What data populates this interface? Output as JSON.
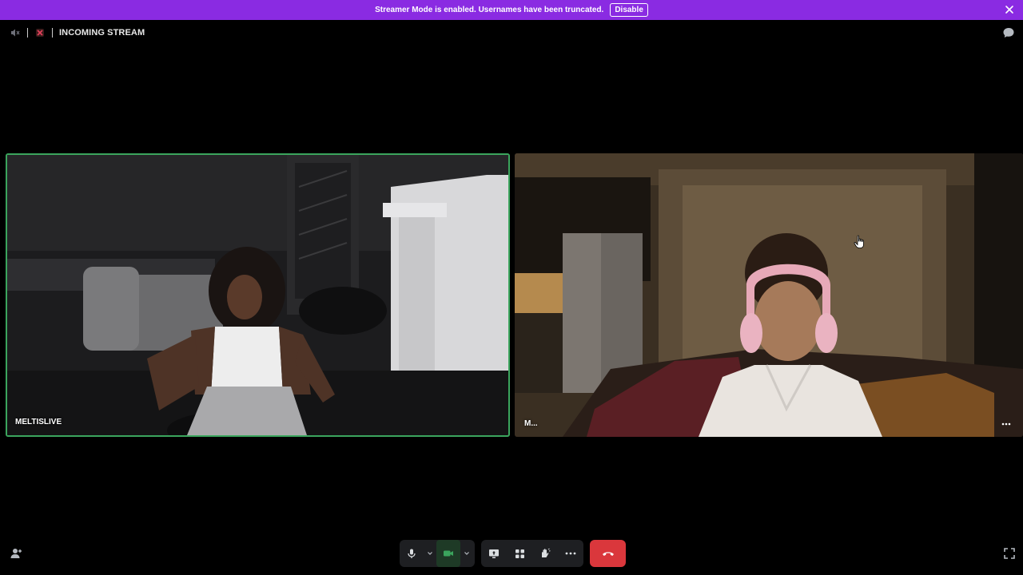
{
  "banner": {
    "message": "Streamer Mode is enabled. Usernames have been truncated.",
    "button_label": "Disable",
    "color": "#8a2be2"
  },
  "header": {
    "title": "INCOMING STREAM",
    "left_icon": "speaker-muted-icon",
    "right_icon": "chat-bubble-icon"
  },
  "participants": [
    {
      "name": "MELTISLIVE",
      "speaking": true,
      "speaking_color": "#3ba55d"
    },
    {
      "name": "M..."
    }
  ],
  "controls": {
    "mic_icon": "microphone-icon",
    "camera_icon": "camera-icon",
    "share_icon": "screen-share-icon",
    "activities_icon": "activities-icon",
    "soundboard_icon": "soundboard-icon",
    "more_icon": "more-icon",
    "hangup_icon": "phone-hangup-icon",
    "hangup_color": "#da373c",
    "camera_active_color": "#3ba55d"
  }
}
